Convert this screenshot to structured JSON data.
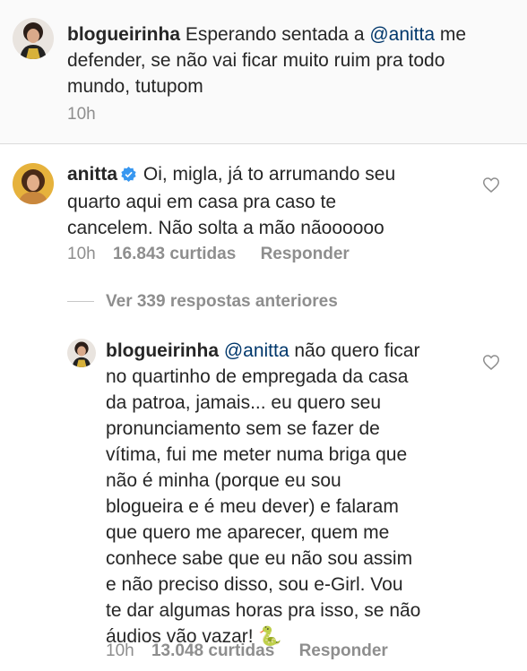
{
  "post": {
    "username": "blogueirinha",
    "text_before": "Esperando sentada a ",
    "mention": "@anitta",
    "text_line1_after": " me",
    "text_line2": "defender, se não vai ficar muito ruim pra todo",
    "text_line3": "mundo, tutupom",
    "time": "10h"
  },
  "comment1": {
    "username": "anitta",
    "verified": true,
    "text_line1": "Oi, migla, já to arrumando seu",
    "text_line2": "quarto aqui em casa pra caso te",
    "text_line3": "cancelem. Não solta a mão nãoooooo",
    "time": "10h",
    "likes": "16.843 curtidas",
    "reply_label": "Responder"
  },
  "view_replies": {
    "label": "Ver 339 respostas anteriores"
  },
  "reply1": {
    "username": "blogueirinha",
    "mention": "@anitta",
    "text_line1_after": " não quero ficar",
    "lines": [
      "no quartinho de empregada da casa",
      "da patroa, jamais... eu quero seu",
      "pronunciamento sem se fazer de",
      "vítima, fui me meter numa briga que",
      "não é minha (porque eu sou",
      "blogueira e é meu dever) e falaram",
      "que quero me aparecer, quem me",
      "conhece sabe que eu não sou assim",
      "e não preciso disso, sou e-Girl. Vou",
      "te dar algumas horas pra isso, se não",
      "áudios vão vazar! 🐍"
    ],
    "time": "10h",
    "likes": "13.048 curtidas",
    "reply_label": "Responder"
  },
  "colors": {
    "text": "#262626",
    "secondary": "#8e8e8e",
    "mention": "#00376b",
    "verified": "#3897f0",
    "post_background": "#fafafa"
  },
  "icons": {
    "like": "heart-icon",
    "verified": "verified-badge-icon",
    "emoji": "snake-emoji"
  }
}
